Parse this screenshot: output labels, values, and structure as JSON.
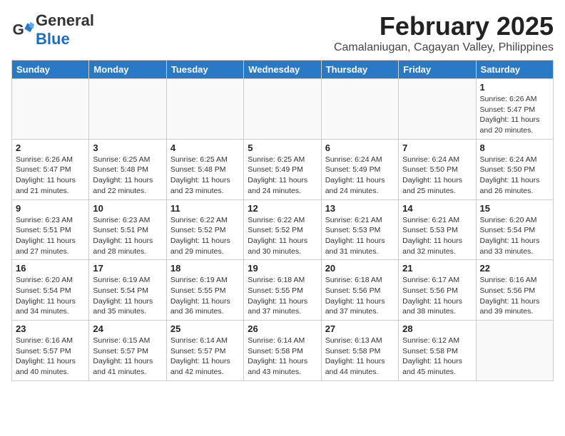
{
  "logo": {
    "general": "General",
    "blue": "Blue"
  },
  "title": {
    "month_year": "February 2025",
    "location": "Camalaniugan, Cagayan Valley, Philippines"
  },
  "weekdays": [
    "Sunday",
    "Monday",
    "Tuesday",
    "Wednesday",
    "Thursday",
    "Friday",
    "Saturday"
  ],
  "weeks": [
    [
      {
        "day": null
      },
      {
        "day": null
      },
      {
        "day": null
      },
      {
        "day": null
      },
      {
        "day": null
      },
      {
        "day": null
      },
      {
        "day": "1",
        "sunrise": "6:26 AM",
        "sunset": "5:47 PM",
        "daylight": "11 hours and 20 minutes."
      }
    ],
    [
      {
        "day": "2",
        "sunrise": "6:26 AM",
        "sunset": "5:47 PM",
        "daylight": "11 hours and 21 minutes."
      },
      {
        "day": "3",
        "sunrise": "6:25 AM",
        "sunset": "5:48 PM",
        "daylight": "11 hours and 22 minutes."
      },
      {
        "day": "4",
        "sunrise": "6:25 AM",
        "sunset": "5:48 PM",
        "daylight": "11 hours and 23 minutes."
      },
      {
        "day": "5",
        "sunrise": "6:25 AM",
        "sunset": "5:49 PM",
        "daylight": "11 hours and 24 minutes."
      },
      {
        "day": "6",
        "sunrise": "6:24 AM",
        "sunset": "5:49 PM",
        "daylight": "11 hours and 24 minutes."
      },
      {
        "day": "7",
        "sunrise": "6:24 AM",
        "sunset": "5:50 PM",
        "daylight": "11 hours and 25 minutes."
      },
      {
        "day": "8",
        "sunrise": "6:24 AM",
        "sunset": "5:50 PM",
        "daylight": "11 hours and 26 minutes."
      }
    ],
    [
      {
        "day": "9",
        "sunrise": "6:23 AM",
        "sunset": "5:51 PM",
        "daylight": "11 hours and 27 minutes."
      },
      {
        "day": "10",
        "sunrise": "6:23 AM",
        "sunset": "5:51 PM",
        "daylight": "11 hours and 28 minutes."
      },
      {
        "day": "11",
        "sunrise": "6:22 AM",
        "sunset": "5:52 PM",
        "daylight": "11 hours and 29 minutes."
      },
      {
        "day": "12",
        "sunrise": "6:22 AM",
        "sunset": "5:52 PM",
        "daylight": "11 hours and 30 minutes."
      },
      {
        "day": "13",
        "sunrise": "6:21 AM",
        "sunset": "5:53 PM",
        "daylight": "11 hours and 31 minutes."
      },
      {
        "day": "14",
        "sunrise": "6:21 AM",
        "sunset": "5:53 PM",
        "daylight": "11 hours and 32 minutes."
      },
      {
        "day": "15",
        "sunrise": "6:20 AM",
        "sunset": "5:54 PM",
        "daylight": "11 hours and 33 minutes."
      }
    ],
    [
      {
        "day": "16",
        "sunrise": "6:20 AM",
        "sunset": "5:54 PM",
        "daylight": "11 hours and 34 minutes."
      },
      {
        "day": "17",
        "sunrise": "6:19 AM",
        "sunset": "5:54 PM",
        "daylight": "11 hours and 35 minutes."
      },
      {
        "day": "18",
        "sunrise": "6:19 AM",
        "sunset": "5:55 PM",
        "daylight": "11 hours and 36 minutes."
      },
      {
        "day": "19",
        "sunrise": "6:18 AM",
        "sunset": "5:55 PM",
        "daylight": "11 hours and 37 minutes."
      },
      {
        "day": "20",
        "sunrise": "6:18 AM",
        "sunset": "5:56 PM",
        "daylight": "11 hours and 37 minutes."
      },
      {
        "day": "21",
        "sunrise": "6:17 AM",
        "sunset": "5:56 PM",
        "daylight": "11 hours and 38 minutes."
      },
      {
        "day": "22",
        "sunrise": "6:16 AM",
        "sunset": "5:56 PM",
        "daylight": "11 hours and 39 minutes."
      }
    ],
    [
      {
        "day": "23",
        "sunrise": "6:16 AM",
        "sunset": "5:57 PM",
        "daylight": "11 hours and 40 minutes."
      },
      {
        "day": "24",
        "sunrise": "6:15 AM",
        "sunset": "5:57 PM",
        "daylight": "11 hours and 41 minutes."
      },
      {
        "day": "25",
        "sunrise": "6:14 AM",
        "sunset": "5:57 PM",
        "daylight": "11 hours and 42 minutes."
      },
      {
        "day": "26",
        "sunrise": "6:14 AM",
        "sunset": "5:58 PM",
        "daylight": "11 hours and 43 minutes."
      },
      {
        "day": "27",
        "sunrise": "6:13 AM",
        "sunset": "5:58 PM",
        "daylight": "11 hours and 44 minutes."
      },
      {
        "day": "28",
        "sunrise": "6:12 AM",
        "sunset": "5:58 PM",
        "daylight": "11 hours and 45 minutes."
      },
      {
        "day": null
      }
    ]
  ]
}
